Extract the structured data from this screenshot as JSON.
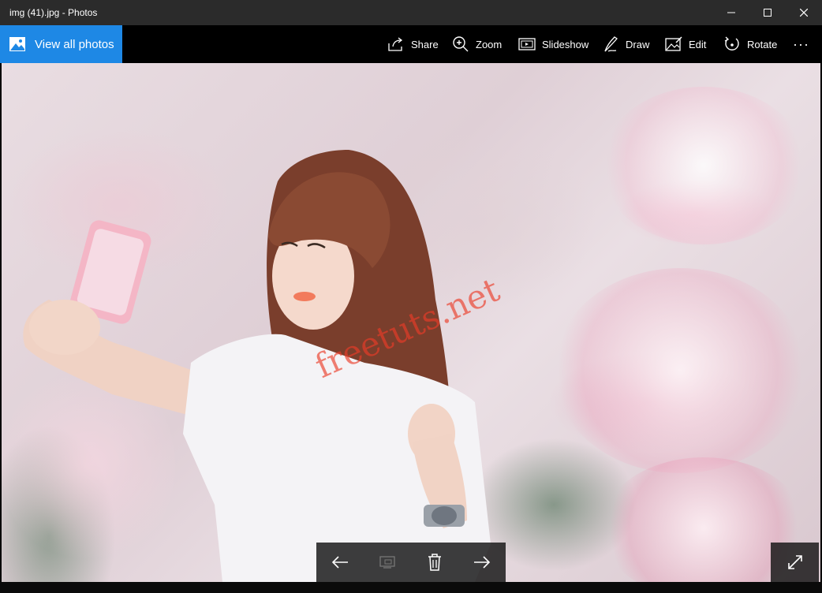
{
  "window": {
    "title": "img (41).jpg - Photos",
    "minimize_icon": "minimize-icon",
    "maximize_icon": "maximize-icon",
    "close_icon": "close-icon"
  },
  "commandbar": {
    "view_all_label": "View all photos",
    "accent_color": "#1e88e5",
    "actions": [
      {
        "label": "Share",
        "icon": "share-icon"
      },
      {
        "label": "Zoom",
        "icon": "zoom-icon"
      },
      {
        "label": "Slideshow",
        "icon": "slideshow-icon"
      },
      {
        "label": "Draw",
        "icon": "draw-icon"
      },
      {
        "label": "Edit",
        "icon": "edit-icon"
      },
      {
        "label": "Rotate",
        "icon": "rotate-icon"
      }
    ],
    "more_label": "···"
  },
  "photo": {
    "watermark": "freetuts.net"
  },
  "navigation": {
    "previous_icon": "arrow-left-icon",
    "set_as_icon": "set-as-icon",
    "delete_icon": "trash-icon",
    "next_icon": "arrow-right-icon",
    "fullscreen_icon": "fullscreen-icon"
  }
}
